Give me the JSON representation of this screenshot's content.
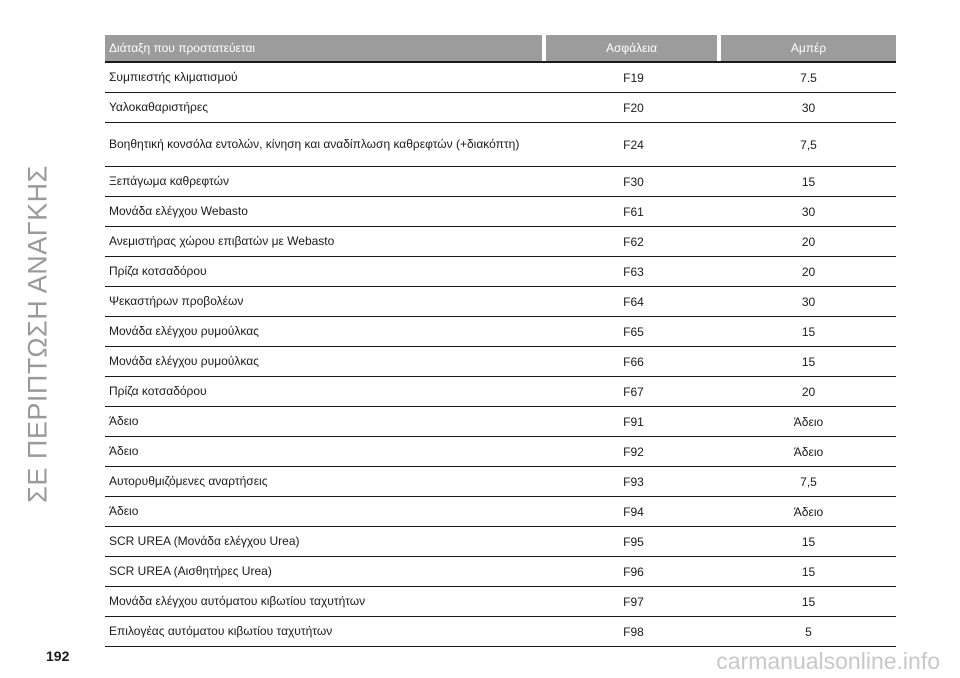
{
  "side_title": "ΣΕ ΠΕΡΙΠΤΩΣΗ ΑΝΑΓΚΗΣ",
  "table": {
    "headers": [
      "Διάταξη που προστατεύεται",
      "Ασφάλεια",
      "Αμπέρ"
    ],
    "rows": [
      {
        "device": "Συμπιεστής κλιματισμού",
        "fuse": "F19",
        "amp": "7.5"
      },
      {
        "device": "Υαλοκαθαριστήρες",
        "fuse": "F20",
        "amp": "30"
      },
      {
        "device": "Βοηθητική κονσόλα εντολών, κίνηση και αναδίπλωση καθρεφτών (+διακόπτη)",
        "fuse": "F24",
        "amp": "7,5"
      },
      {
        "device": "Ξεπάγωμα καθρεφτών",
        "fuse": "F30",
        "amp": "15"
      },
      {
        "device": "Μονάδα ελέγχου Webasto",
        "fuse": "F61",
        "amp": "30"
      },
      {
        "device": "Ανεμιστήρας χώρου επιβατών με Webasto",
        "fuse": "F62",
        "amp": "20"
      },
      {
        "device": "Πρίζα κοτσαδόρου",
        "fuse": "F63",
        "amp": "20"
      },
      {
        "device": "Ψεκαστήρων προβολέων",
        "fuse": "F64",
        "amp": "30"
      },
      {
        "device": "Μονάδα ελέγχου ρυμούλκας",
        "fuse": "F65",
        "amp": "15"
      },
      {
        "device": "Μονάδα ελέγχου ρυμούλκας",
        "fuse": "F66",
        "amp": "15"
      },
      {
        "device": "Πρίζα κοτσαδόρου",
        "fuse": "F67",
        "amp": "20"
      },
      {
        "device": "Άδειο",
        "fuse": "F91",
        "amp": "Άδειο"
      },
      {
        "device": "Άδειο",
        "fuse": "F92",
        "amp": "Άδειο"
      },
      {
        "device": "Αυτορυθμιζόμενες αναρτήσεις",
        "fuse": "F93",
        "amp": "7,5"
      },
      {
        "device": "Άδειο",
        "fuse": "F94",
        "amp": "Άδειο"
      },
      {
        "device": "SCR UREA (Μονάδα ελέγχου Urea)",
        "fuse": "F95",
        "amp": "15"
      },
      {
        "device": "SCR UREA (Αισθητήρες Urea)",
        "fuse": "F96",
        "amp": "15"
      },
      {
        "device": "Μονάδα ελέγχου αυτόματου κιβωτίου ταχυτήτων",
        "fuse": "F97",
        "amp": "15"
      },
      {
        "device": "Επιλογέας αυτόματου κιβωτίου ταχυτήτων",
        "fuse": "F98",
        "amp": "5"
      }
    ]
  },
  "page_number": "192",
  "watermark": "carmanualsonline.info"
}
